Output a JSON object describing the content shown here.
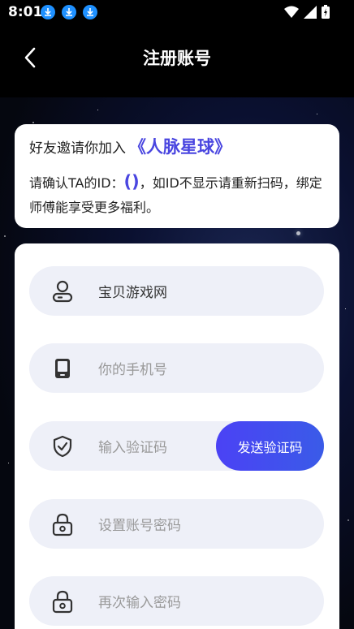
{
  "status": {
    "time": "8:01"
  },
  "header": {
    "title": "注册账号"
  },
  "invite": {
    "prefix": "好友邀请你加入",
    "planet": "《人脉星球》",
    "confirm_prefix": "请确认TA的ID：",
    "id_value": "()",
    "confirm_suffix": "，如ID不显示请重新扫码，绑定师傅能享受更多福利。"
  },
  "form": {
    "invite_name": "宝贝游戏网",
    "phone_placeholder": "你的手机号",
    "code_placeholder": "输入验证码",
    "send_code_label": "发送验证码",
    "password_placeholder": "设置账号密码",
    "confirm_password_placeholder": "再次输入密码"
  },
  "colors": {
    "accent": "#4a46e0",
    "button": "#4b42f5",
    "field_bg": "#eef0f8"
  }
}
